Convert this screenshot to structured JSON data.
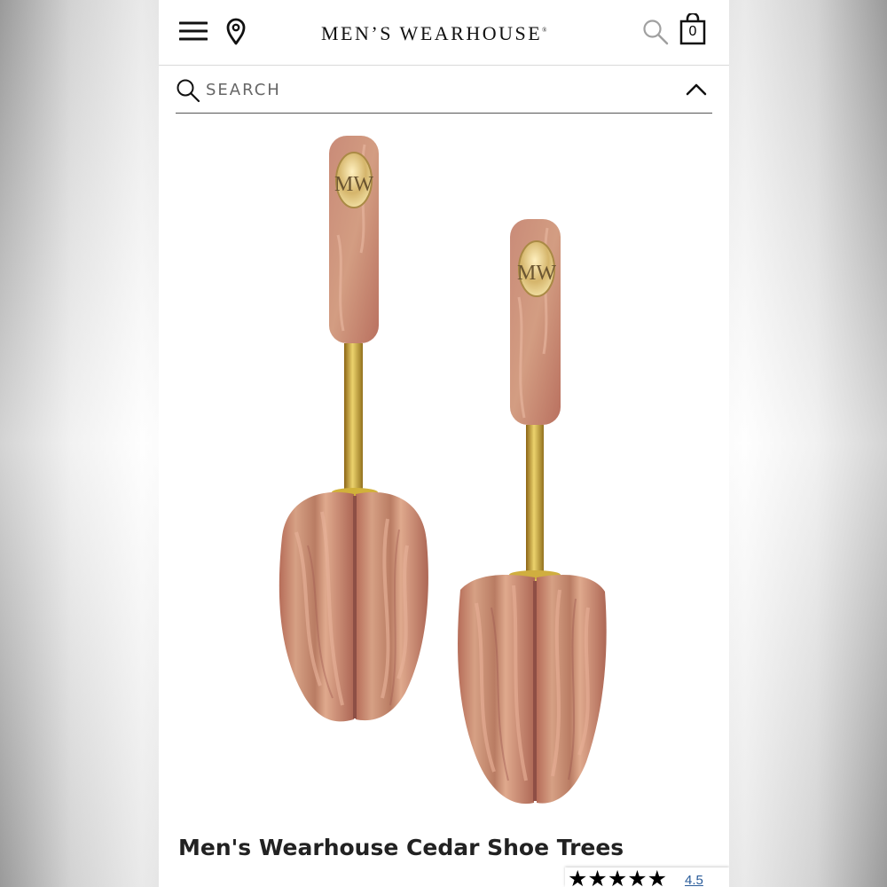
{
  "header": {
    "brand": "MEN’S WEARHOUSE",
    "brand_mark": "®",
    "cart_count": "0",
    "icons": [
      "menu-icon",
      "location-icon",
      "search-icon",
      "shopping-bag-icon"
    ]
  },
  "search": {
    "placeholder": "SEARCH",
    "value": "",
    "icons": [
      "search-icon",
      "chevron-up-icon"
    ]
  },
  "product": {
    "title": "Men's Wearhouse Cedar Shoe Trees",
    "image_alt": "Men's Wearhouse Cedar Shoe Trees",
    "badge_logo": "MW",
    "rating": {
      "value_text": "4.5",
      "stars": 4.5,
      "max": 5,
      "stars_text": "★★★★★"
    }
  },
  "colors": {
    "text": "#111111",
    "cedar_light": "#d49a83",
    "cedar_dark": "#b46d5b",
    "brass": "#c9a640",
    "link": "#2a5c9a"
  }
}
